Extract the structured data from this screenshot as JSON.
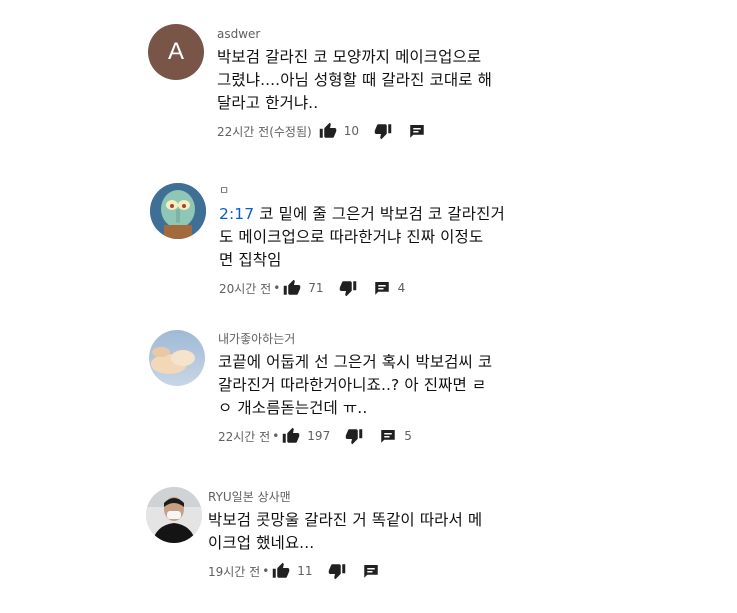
{
  "comments": [
    {
      "author": "asdwer",
      "avatar_letter": "A",
      "avatar_color": "#795548",
      "line1": "박보검 갈라진 코 모양까지 메이크업으로",
      "line2": "그렸냐....아님 성형할 때 갈라진 코대로 해",
      "line3": "달라고 한거냐..",
      "time": "22시간 전(수정됨)",
      "likes": "10",
      "replies": ""
    },
    {
      "author": "ㅁ",
      "timestamp_link": "2:17",
      "line1_rest": " 코 밑에 줄 그은거 박보검 코 갈라진거",
      "line2": "도 메이크업으로 따라한거냐 진짜 이정도",
      "line3": "면 집착임",
      "time": "20시간 전",
      "likes": "71",
      "replies": "4"
    },
    {
      "author": "내가좋아하는거",
      "line1": "코끝에 어둡게 선 그은거 혹시 박보검씨 코",
      "line2": "갈라진거 따라한거아니죠..? 아 진짜면 ㄹ",
      "line3": "ㅇ 개소름돋는건데 ㅠ..",
      "time": "22시간 전",
      "likes": "197",
      "replies": "5"
    },
    {
      "author": "RYU일본 상사맨",
      "line1": "박보검 콧망울 갈라진 거 똑같이 따라서 메",
      "line2": "이크업 했네요...",
      "time": "19시간 전",
      "likes": "11",
      "replies": ""
    }
  ],
  "meta_dot": "•",
  "icons": {
    "like": "thumbs-up-icon",
    "dislike": "thumbs-down-icon",
    "reply": "reply-icon"
  }
}
